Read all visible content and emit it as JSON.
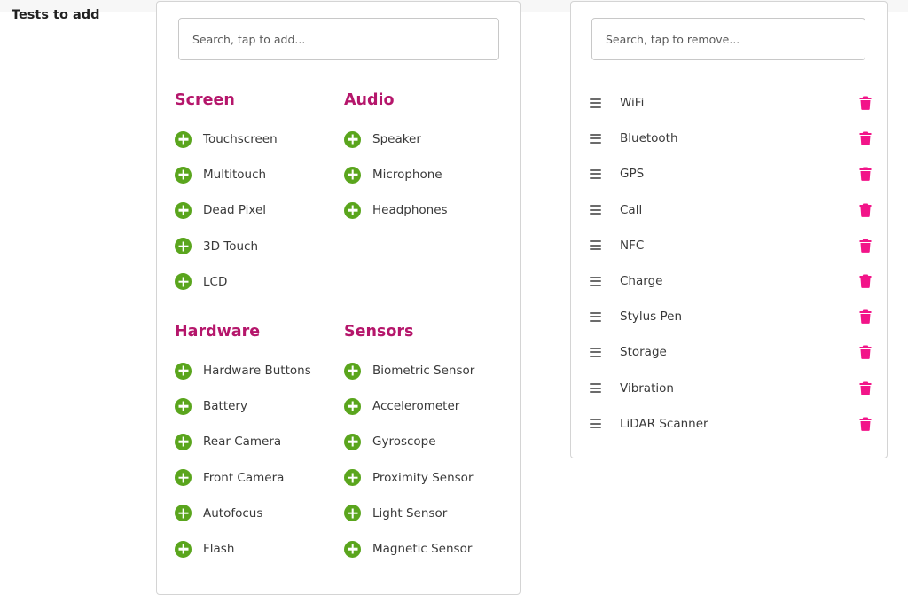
{
  "section_label": "Tests to add",
  "add_panel": {
    "search_placeholder": "Search, tap to add...",
    "categories": [
      {
        "title": "Screen",
        "items": [
          "Touchscreen",
          "Multitouch",
          "Dead Pixel",
          "3D Touch",
          "LCD"
        ]
      },
      {
        "title": "Audio",
        "items": [
          "Speaker",
          "Microphone",
          "Headphones"
        ]
      },
      {
        "title": "Hardware",
        "items": [
          "Hardware Buttons",
          "Battery",
          "Rear Camera",
          "Front Camera",
          "Autofocus",
          "Flash"
        ]
      },
      {
        "title": "Sensors",
        "items": [
          "Biometric Sensor",
          "Accelerometer",
          "Gyroscope",
          "Proximity Sensor",
          "Light Sensor",
          "Magnetic Sensor"
        ]
      }
    ]
  },
  "selected_panel": {
    "search_placeholder": "Search, tap to remove...",
    "items": [
      "WiFi",
      "Bluetooth",
      "GPS",
      "Call",
      "NFC",
      "Charge",
      "Stylus Pen",
      "Storage",
      "Vibration",
      "LiDAR Scanner"
    ]
  },
  "colors": {
    "category_title": "#b5166b",
    "add_icon": "#5aa51d",
    "remove_icon": "#f21489",
    "drag_handle": "#6b6b6b"
  },
  "icons": {
    "add": "plus-circle-icon",
    "remove": "trash-icon",
    "reorder": "drag-handle-icon"
  }
}
